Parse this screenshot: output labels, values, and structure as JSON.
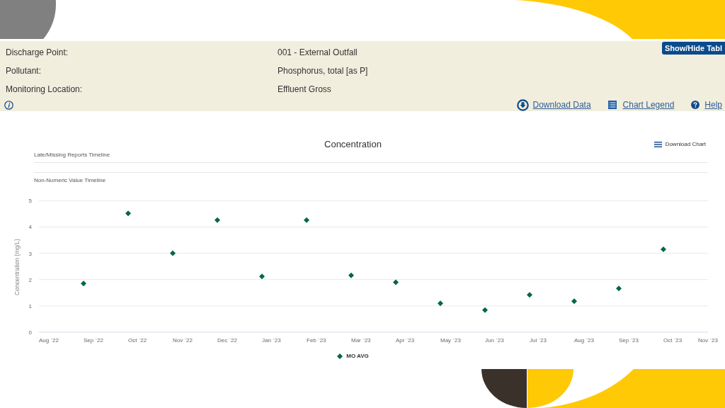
{
  "details": [
    {
      "label": "Discharge Point:",
      "value": "001 - External Outfall"
    },
    {
      "label": "Pollutant:",
      "value": "Phosphorus, total [as P]"
    },
    {
      "label": "Monitoring Location:",
      "value": "Effluent Gross"
    }
  ],
  "table_toggle": {
    "label": "Show/Hide Tabl"
  },
  "links": {
    "download_data": "Download Data",
    "chart_legend": "Chart Legend",
    "help": "Help"
  },
  "chart": {
    "download_button": "Download Chart",
    "timelines": [
      "Late/Missing Reports Timeline",
      "Non-Numeric Value Timeline"
    ],
    "chart_data": {
      "type": "scatter",
      "title": "Concentration",
      "ylabel": "Concentration (mg/L)",
      "categories": [
        "Aug `22",
        "Sep `22",
        "Oct `22",
        "Nov `22",
        "Dec `22",
        "Jan `23",
        "Feb `23",
        "Mar `23",
        "Apr `23",
        "May `23",
        "Jun `23",
        "Jul `23",
        "Aug `23",
        "Sep `23",
        "Oct `23",
        "Nov `23"
      ],
      "series": [
        {
          "name": "MO AVG",
          "color": "#00693e",
          "values": [
            null,
            1.85,
            4.52,
            3.0,
            4.26,
            2.12,
            4.26,
            2.16,
            1.9,
            1.1,
            0.84,
            1.42,
            1.18,
            1.66,
            3.15,
            null
          ]
        }
      ],
      "ylim": [
        0,
        5
      ],
      "yticks": [
        0,
        1,
        2,
        3,
        4,
        5
      ],
      "grid": true
    }
  }
}
